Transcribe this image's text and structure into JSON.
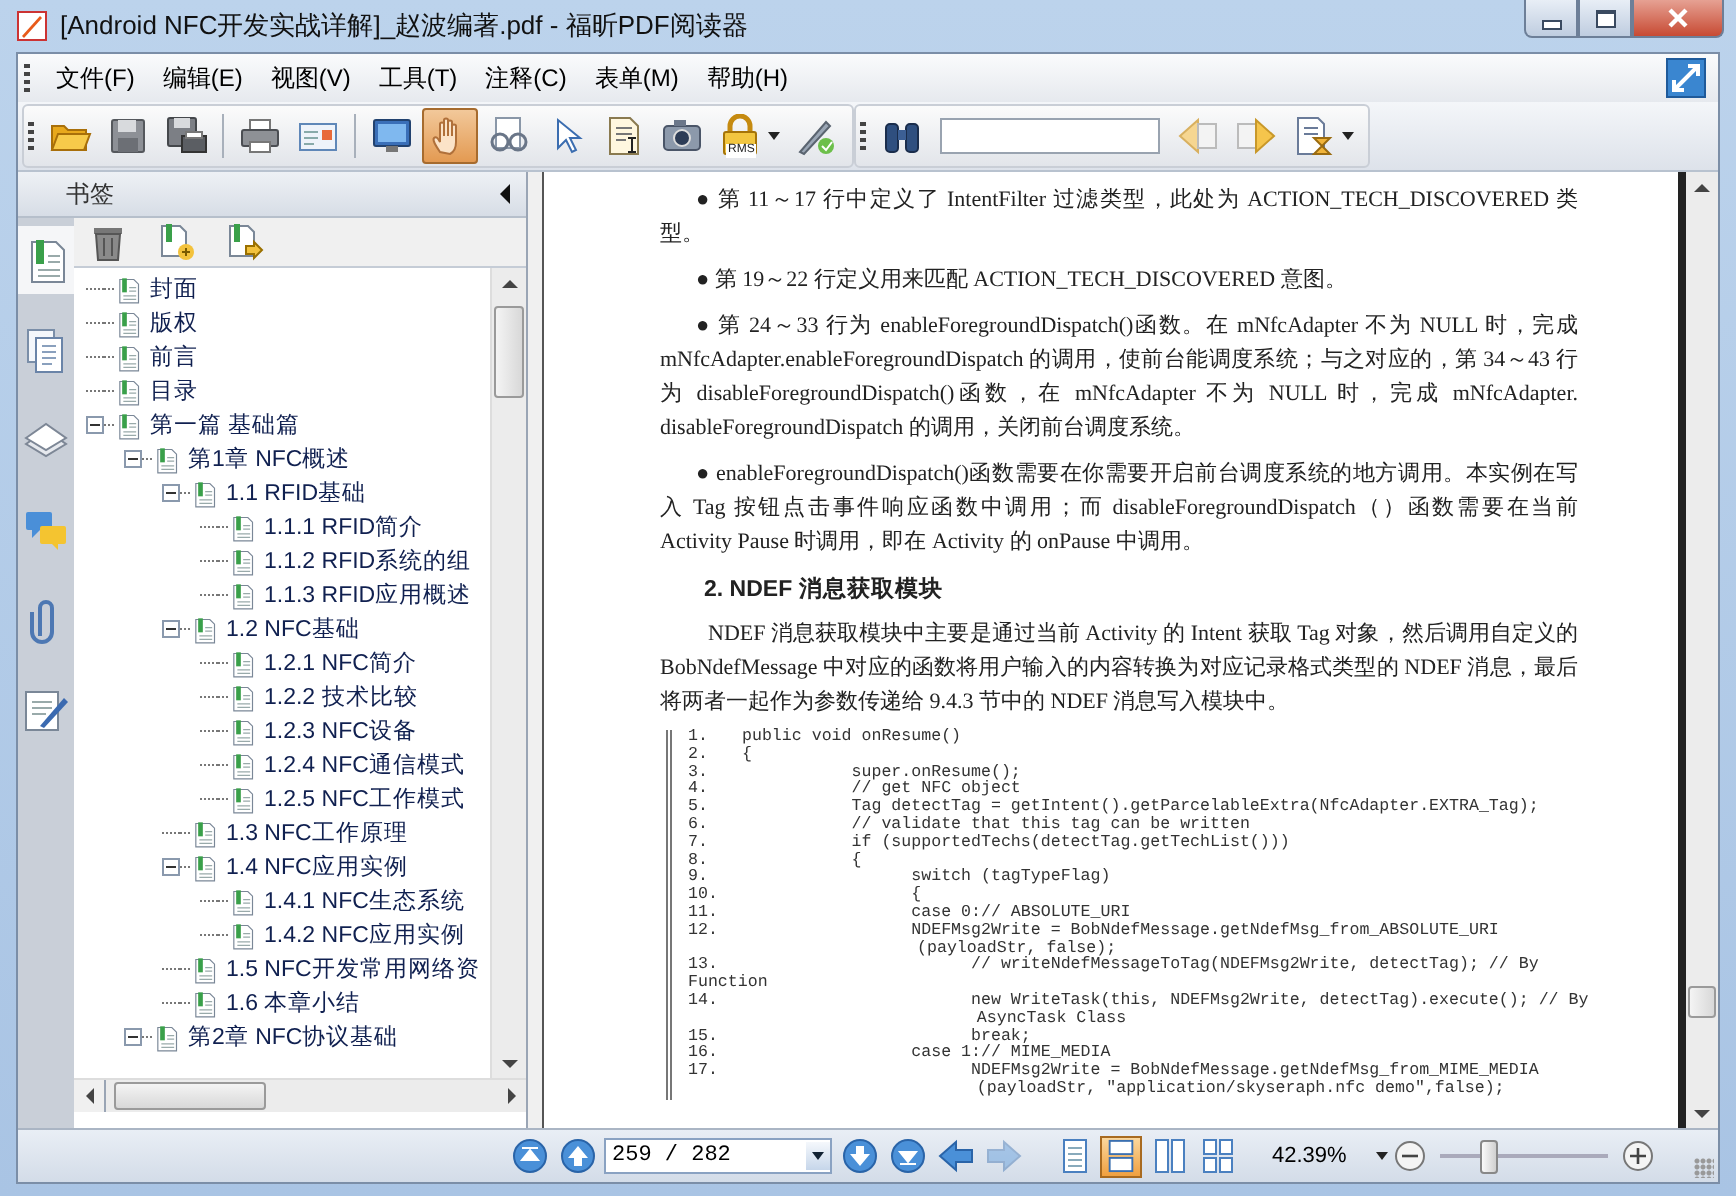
{
  "window": {
    "title": "[Android NFC开发实战详解]_赵波编著.pdf - 福昕PDF阅读器"
  },
  "menu": [
    {
      "label": "文件(F)"
    },
    {
      "label": "编辑(E)"
    },
    {
      "label": "视图(V)"
    },
    {
      "label": "工具(T)"
    },
    {
      "label": "注释(C)"
    },
    {
      "label": "表单(M)"
    },
    {
      "label": "帮助(H)"
    }
  ],
  "toolbar": {
    "tools": [
      {
        "kind": "folder",
        "selected": false
      },
      {
        "kind": "floppy",
        "selected": false
      },
      {
        "kind": "floppy-printer",
        "selected": false
      },
      {
        "kind": "separator"
      },
      {
        "kind": "printer",
        "selected": false
      },
      {
        "kind": "card",
        "selected": false
      },
      {
        "kind": "separator"
      },
      {
        "kind": "monitor",
        "selected": false
      },
      {
        "kind": "hand",
        "selected": true
      },
      {
        "kind": "glasses",
        "selected": false
      },
      {
        "kind": "cursor",
        "selected": false
      },
      {
        "kind": "document",
        "selected": false
      },
      {
        "kind": "camera",
        "selected": false
      },
      {
        "kind": "lock",
        "selected": false,
        "label": "RMS"
      },
      {
        "kind": "pen",
        "selected": false
      },
      {
        "kind": "grip"
      },
      {
        "kind": "binoculars",
        "selected": false
      },
      {
        "kind": "search"
      },
      {
        "kind": "left-arrow",
        "selected": false
      },
      {
        "kind": "right-arrow",
        "selected": false
      },
      {
        "kind": "hourglass",
        "selected": false
      }
    ]
  },
  "bookmarks": {
    "title": "书签",
    "side_tabs": [
      {
        "kind": "bookmark",
        "selected": true
      },
      {
        "kind": "pages",
        "selected": false
      },
      {
        "kind": "layers",
        "selected": false
      },
      {
        "kind": "comments",
        "selected": false
      },
      {
        "kind": "paperclip",
        "selected": false
      },
      {
        "kind": "signature",
        "selected": false
      }
    ],
    "tools": [
      {
        "kind": "trash"
      },
      {
        "kind": "add"
      },
      {
        "kind": "forward"
      }
    ],
    "tree": [
      {
        "label": "封面"
      },
      {
        "label": "版权"
      },
      {
        "label": "前言"
      },
      {
        "label": "目录"
      },
      {
        "label": "第一篇 基础篇",
        "expanded": true,
        "children": [
          {
            "label": "第1章 NFC概述",
            "expanded": true,
            "children": [
              {
                "label": "1.1 RFID基础",
                "expanded": true,
                "children": [
                  {
                    "label": "1.1.1 RFID简介"
                  },
                  {
                    "label": "1.1.2 RFID系统的组"
                  },
                  {
                    "label": "1.1.3 RFID应用概述"
                  }
                ]
              },
              {
                "label": "1.2 NFC基础",
                "expanded": true,
                "children": [
                  {
                    "label": "1.2.1 NFC简介"
                  },
                  {
                    "label": "1.2.2 技术比较"
                  },
                  {
                    "label": "1.2.3 NFC设备"
                  },
                  {
                    "label": "1.2.4 NFC通信模式"
                  },
                  {
                    "label": "1.2.5 NFC工作模式"
                  }
                ]
              },
              {
                "label": "1.3 NFC工作原理"
              },
              {
                "label": "1.4 NFC应用实例",
                "expanded": true,
                "children": [
                  {
                    "label": "1.4.1 NFC生态系统"
                  },
                  {
                    "label": "1.4.2 NFC应用实例"
                  }
                ]
              },
              {
                "label": "1.5 NFC开发常用网络资"
              },
              {
                "label": "1.6 本章小结"
              }
            ]
          },
          {
            "label": "第2章 NFC协议基础",
            "expanded": true
          }
        ]
      }
    ]
  },
  "document": {
    "blocks": [
      {
        "kind": "bullet",
        "text": "●  第 11～17 行中定义了 IntentFilter 过滤类型，此处为 ACTION_TECH_DISCOVERED 类型。"
      },
      {
        "kind": "bullet",
        "text": "●  第 19～22 行定义用来匹配 ACTION_TECH_DISCOVERED 意图。"
      },
      {
        "kind": "bullet",
        "text": "●  第 24～33 行为 enableForegroundDispatch()函数。在 mNfcAdapter 不为 NULL 时，完成 mNfcAdapter.enableForegroundDispatch 的调用，使前台能调度系统；与之对应的，第 34～43 行为 disableForegroundDispatch()函数，在 mNfcAdapter 不为 NULL 时，完成 mNfcAdapter. disableForegroundDispatch 的调用，关闭前台调度系统。"
      },
      {
        "kind": "bullet",
        "text": "●  enableForegroundDispatch()函数需要在你需要开启前台调度系统的地方调用。本实例在写入 Tag 按钮点击事件响应函数中调用；而 disableForegroundDispatch（）函数需要在当前 Activity Pause 时调用，即在 Activity 的 onPause 中调用。"
      },
      {
        "kind": "heading",
        "text": "2.  NDEF 消息获取模块"
      },
      {
        "kind": "body",
        "text": "NDEF 消息获取模块中主要是通过当前 Activity 的 Intent 获取 Tag 对象，然后调用自定义的 BobNdefMessage 中对应的函数将用户输入的内容转换为对应记录格式类型的 NDEF 消息，最后将两者一起作为参数传递给 9.4.3 节中的 NDEF 消息写入模块中。"
      }
    ],
    "code": [
      {
        "number": "1.",
        "text": "public void onResume()"
      },
      {
        "number": "2.",
        "text": "{"
      },
      {
        "number": "3.",
        "text": "           super.onResume();"
      },
      {
        "number": "4.",
        "text": "           // get NFC object"
      },
      {
        "number": "5.",
        "text": "           Tag detectTag = getIntent().getParcelableExtra(NfcAdapter.EXTRA_Tag);"
      },
      {
        "number": "6.",
        "text": "           // validate that this tag can be written"
      },
      {
        "number": "7.",
        "text": "           if (supportedTechs(detectTag.getTechList()))"
      },
      {
        "number": "8.",
        "text": "           {"
      },
      {
        "number": "9.",
        "text": "                 switch (tagTypeFlag)"
      },
      {
        "number": "10.",
        "text": "                 {"
      },
      {
        "number": "11.",
        "text": "                 case 0:// ABSOLUTE_URI"
      },
      {
        "number": "12.",
        "text": "                 NDEFMsg2Write = BobNdefMessage.getNdefMsg_from_ABSOLUTE_URI"
      },
      {
        "text": "                       (payloadStr, false);"
      },
      {
        "number": "13.",
        "text": "                       // writeNdefMessageToTag(NDEFMsg2Write, detectTag); // By"
      },
      {
        "text": "Function"
      },
      {
        "number": "14.",
        "text": "                       new WriteTask(this, NDEFMsg2Write, detectTag).execute(); // By"
      },
      {
        "text": "                             AsyncTask Class"
      },
      {
        "number": "15.",
        "text": "                       break;"
      },
      {
        "number": "16.",
        "text": "                 case 1:// MIME_MEDIA"
      },
      {
        "number": "17.",
        "text": "                       NDEFMsg2Write = BobNdefMessage.getNdefMsg_from_MIME_MEDIA"
      },
      {
        "text": "                             (payloadStr, \"application/skyseraph.nfc demo\",false);"
      }
    ]
  },
  "status_bar": {
    "nav": [
      {
        "kind": "first",
        "disabled": false
      },
      {
        "kind": "prev",
        "disabled": false
      }
    ],
    "page": "259 / 282",
    "nav2": [
      {
        "kind": "next",
        "disabled": false
      },
      {
        "kind": "last",
        "disabled": false
      },
      {
        "kind": "back",
        "disabled": false
      },
      {
        "kind": "forward",
        "disabled": true
      }
    ],
    "view_modes": [
      {
        "kind": "single",
        "selected": false
      },
      {
        "kind": "continuous",
        "selected": true
      },
      {
        "kind": "facing",
        "selected": false
      },
      {
        "kind": "grid",
        "selected": false
      }
    ],
    "zoom": "42.39%",
    "zoom_slider": {
      "level": 0.27
    }
  }
}
